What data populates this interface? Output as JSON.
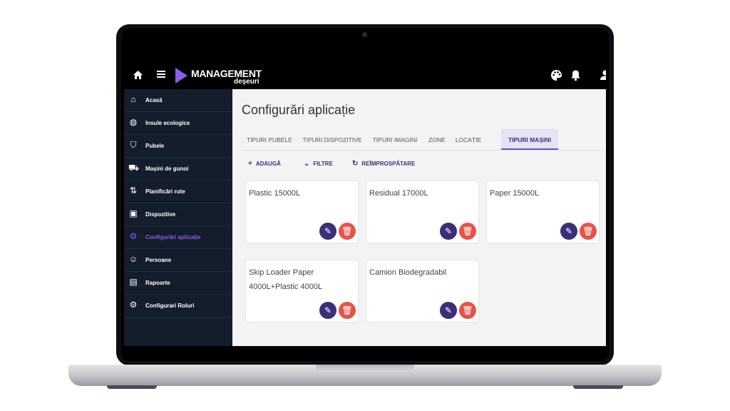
{
  "app": {
    "logo_title": "MANAGEMENT",
    "logo_subtitle": "deșeuri",
    "accent_color": "#8c5cf0",
    "primary_color": "#3d2e7a",
    "danger_color": "#e55448"
  },
  "topbar": {
    "home_icon": "home-icon",
    "menu_icon": "menu-icon",
    "palette_icon": "palette-icon",
    "bell_icon": "bell-icon",
    "user_icon": "user-icon"
  },
  "sidebar": {
    "items": [
      {
        "label": "Acasă",
        "icon": "house-icon",
        "glyph": "⌂"
      },
      {
        "label": "Insule ecologice",
        "icon": "globe-icon",
        "glyph": "◍"
      },
      {
        "label": "Pubele",
        "icon": "bin-icon",
        "glyph": "⛉"
      },
      {
        "label": "Mașini de gunoi",
        "icon": "truck-icon",
        "glyph": "⛟"
      },
      {
        "label": "Planificări rute",
        "icon": "route-icon",
        "glyph": "⇅"
      },
      {
        "label": "Dispozitive",
        "icon": "chip-icon",
        "glyph": "▣"
      },
      {
        "label": "Configurări aplicație",
        "icon": "gear-icon",
        "glyph": "⚙"
      },
      {
        "label": "Persoane",
        "icon": "people-icon",
        "glyph": "☺"
      },
      {
        "label": "Rapoarte",
        "icon": "report-icon",
        "glyph": "▤"
      },
      {
        "label": "Configurari Roluri",
        "icon": "gear-icon",
        "glyph": "⚙"
      }
    ],
    "active_index": 6
  },
  "main": {
    "title": "Configurări aplicație",
    "tabs": [
      {
        "label": "TIPURI PUBELE"
      },
      {
        "label": "TIPURI DISPOZITIVE"
      },
      {
        "label": "TIPURI IMAGINI"
      },
      {
        "label": "ZONE"
      },
      {
        "label": "LOCAȚIE"
      },
      {
        "label": "TIPURI MAȘINI"
      }
    ],
    "active_tab": 5,
    "actions": {
      "add": "ADAUGĂ",
      "filter": "FILTRE",
      "refresh": "REÎMPROSPĂTARE"
    },
    "cards": [
      {
        "name": "Plastic 15000L"
      },
      {
        "name": "Residual 17000L"
      },
      {
        "name": "Paper 15000L"
      },
      {
        "name": "Skip Loader Paper 4000L+Plastic 4000L"
      },
      {
        "name": "Camion Biodegradabil"
      }
    ]
  }
}
